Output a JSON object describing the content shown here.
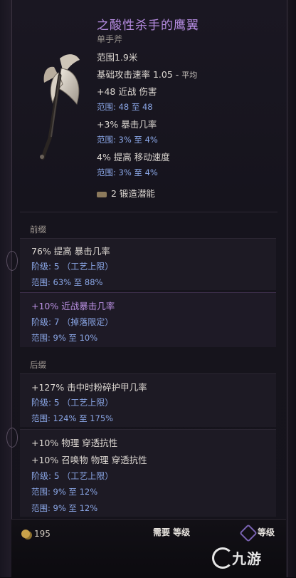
{
  "item": {
    "name": "之酸性杀手的鹰翼",
    "type": "单手斧",
    "stats": {
      "range": "范围1.9米",
      "attack_speed_label": "基础攻击速率 1.05 - ",
      "attack_speed_tag": "平均",
      "melee_damage": "+48 近战 伤害",
      "melee_damage_range": "范围: 48 至 48",
      "crit_chance": "+3% 暴击几率",
      "crit_chance_range": "范围: 3% 至 4%",
      "move_speed": "4% 提高 移动速度",
      "move_speed_range": "范围: 3% 至 4%"
    },
    "forge_potential": "2 锻造潜能"
  },
  "prefix": {
    "label": "前缀",
    "mods": [
      {
        "line": "76% 提高 暴击几率",
        "tier": "阶级: 5  （工艺上限）",
        "range": "范围: 63% 至 88%"
      },
      {
        "line": "+10% 近战暴击几率",
        "tier": "阶级: 7  （掉落限定）",
        "range": "范围: 9% 至 10%"
      }
    ]
  },
  "suffix": {
    "label": "后缀",
    "mods": [
      {
        "line": "+127% 击中时粉碎护甲几率",
        "tier": "阶级: 5  （工艺上限）",
        "range": "范围: 124% 至 175%"
      },
      {
        "line1": "+10% 物理 穿透抗性",
        "line2": "+10% 召唤物 物理 穿透抗性",
        "tier": "阶级: 5  （工艺上限）",
        "range1": "范围: 9% 至 12%",
        "range2": "范围: 9% 至 12%"
      }
    ]
  },
  "footer": {
    "gold": "195",
    "requirement": "需要 等级",
    "requirement_suffix": "等级",
    "watermark": "九游"
  },
  "colors": {
    "title": "#b58be0",
    "blue": "#8aa6e6",
    "purple_mod": "#b88fe0"
  }
}
